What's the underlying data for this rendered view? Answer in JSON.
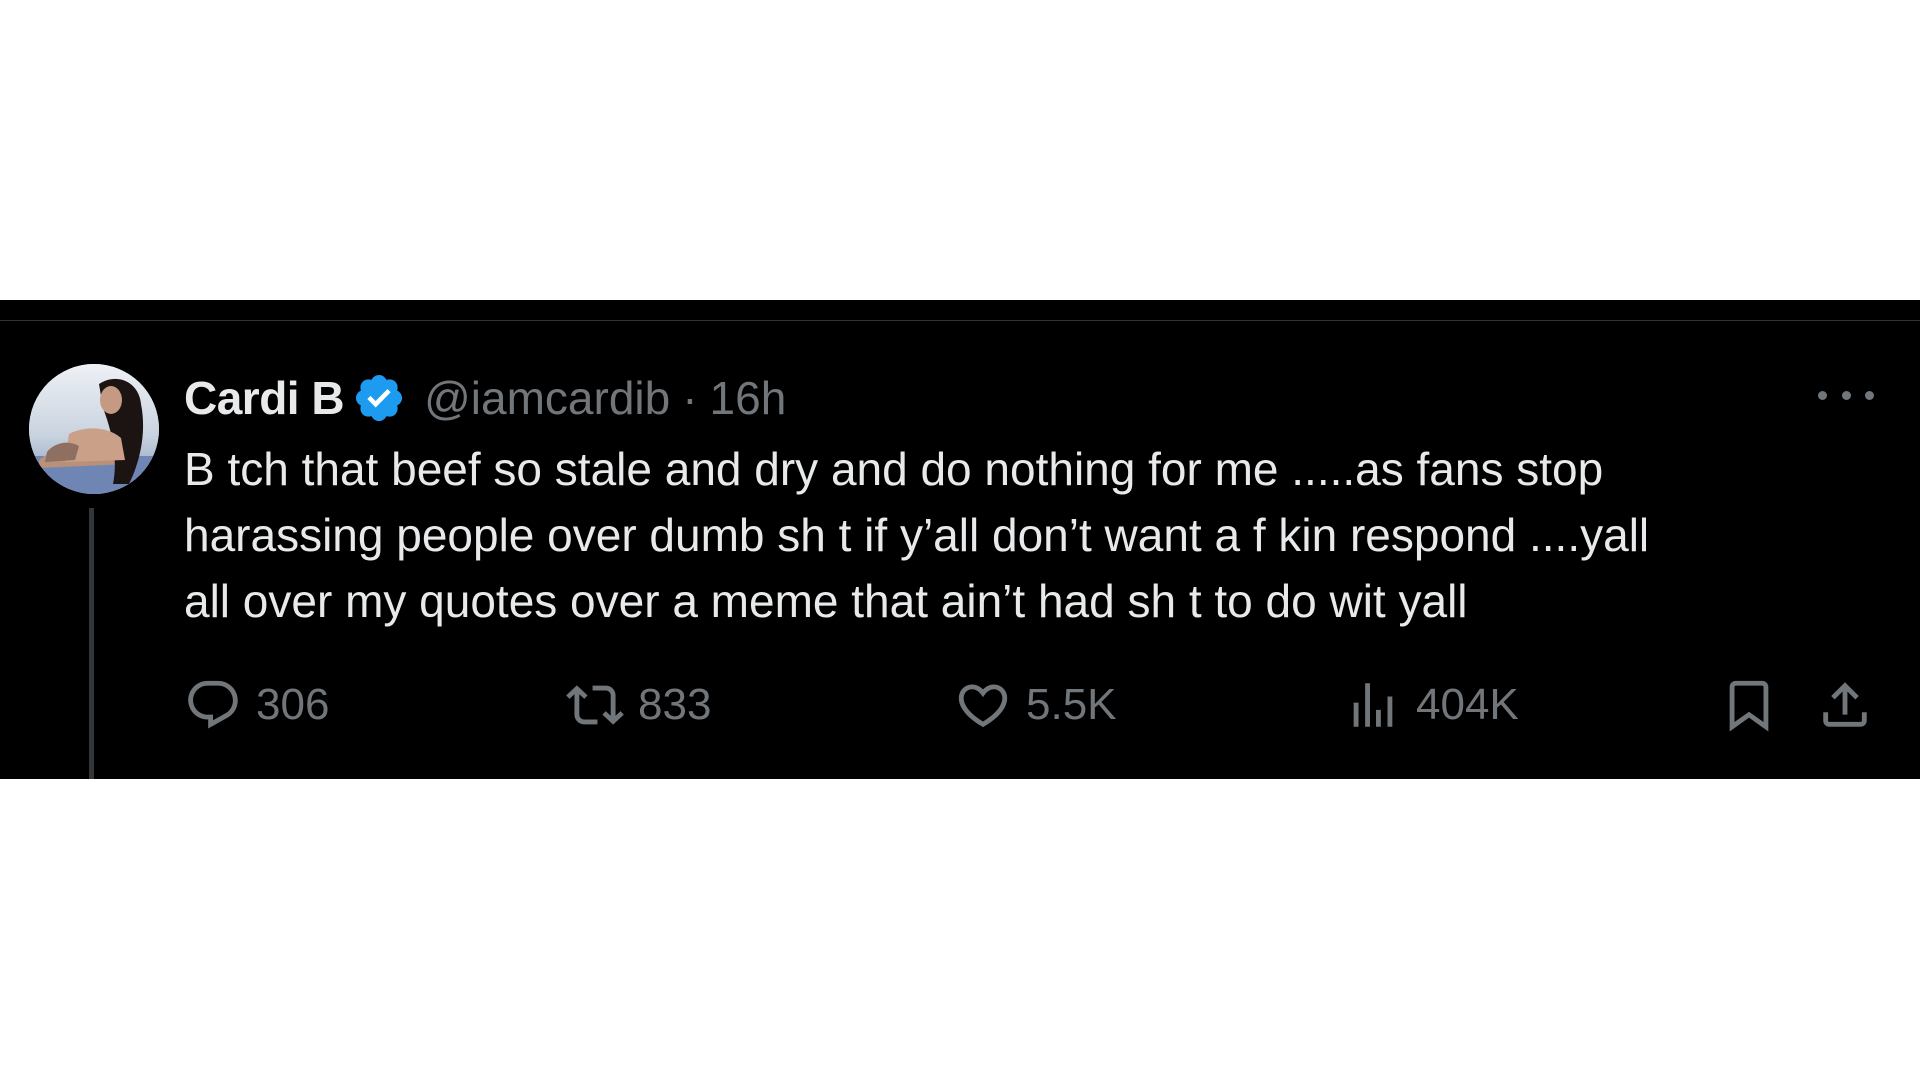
{
  "tweet": {
    "display_name": "Cardi B",
    "handle": "@iamcardib",
    "separator": "·",
    "time": "16h",
    "text_lines": [
      "B tch that beef so stale and dry and do nothing for me .....as fans stop",
      "harassing people over dumb sh t if y’all don’t want a f     kin respond ....yall",
      "all over my quotes over a meme that ain’t had sh t to do wit yall"
    ],
    "verified": true
  },
  "actions": {
    "reply_count": "306",
    "retweet_count": "833",
    "like_count": "5.5K",
    "views_count": "404K"
  },
  "icons": {
    "verified": "verified-badge-icon",
    "more": "more-options-icon",
    "reply": "reply-icon",
    "retweet": "retweet-icon",
    "like": "heart-icon",
    "views": "views-bar-chart-icon",
    "bookmark": "bookmark-icon",
    "share": "share-icon"
  },
  "colors": {
    "background": "#000000",
    "text_primary": "#e7e9ea",
    "text_secondary": "#71767b",
    "verified_blue": "#1d9bf0",
    "thread_line": "#333639"
  }
}
